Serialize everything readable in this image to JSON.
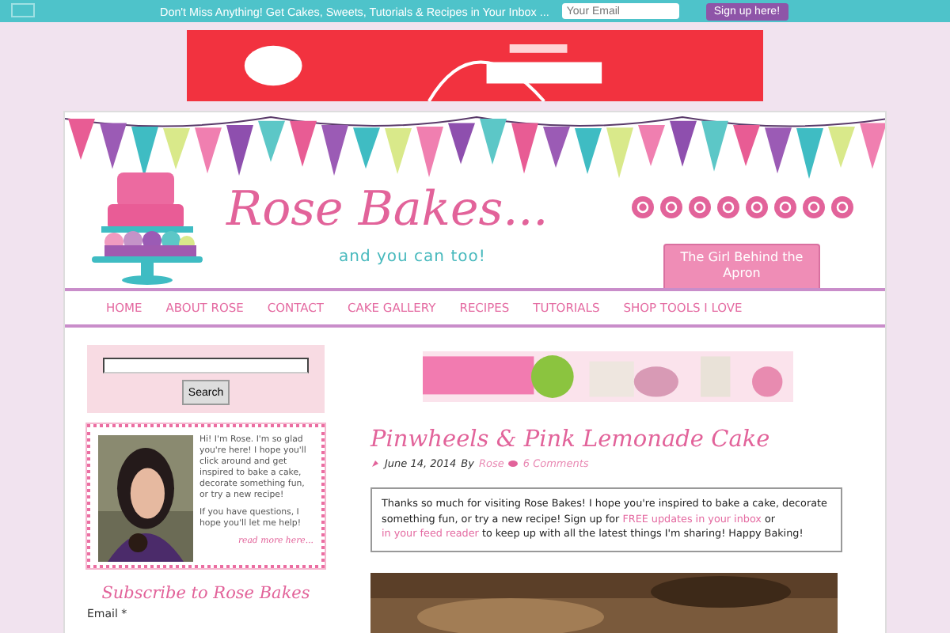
{
  "top_bar": {
    "message": "Don't Miss Anything! Get Cakes, Sweets, Tutorials & Recipes in Your Inbox ...",
    "email_placeholder": "Your Email",
    "button": "Sign up here!"
  },
  "header": {
    "logo_title": "Rose Bakes...",
    "tagline": "and you can too!",
    "about_tab": "The Girl Behind the Apron"
  },
  "nav": {
    "items": [
      "HOME",
      "ABOUT ROSE",
      "CONTACT",
      "CAKE GALLERY",
      "RECIPES",
      "TUTORIALS",
      "SHOP TOOLS I LOVE"
    ]
  },
  "sidebar": {
    "search_button": "Search",
    "about": {
      "paragraphs": [
        "Hi! I'm Rose.  I'm so glad you're here!  I hope you'll click around and get inspired to bake a cake, decorate something fun, or try a new recipe!",
        "If you have questions, I hope you'll let me help!"
      ],
      "link": "read more here..."
    },
    "subscribe_title": "Subscribe to Rose Bakes",
    "email_label": "Email *"
  },
  "post": {
    "title": "Pinwheels & Pink Lemonade Cake",
    "date": "June 14, 2014",
    "by": "By",
    "author": "Rose",
    "comments": "6 Comments",
    "notice": [
      {
        "text": "Thanks so much for visiting Rose Bakes! I hope you're inspired to bake a cake, decorate something fun, or try a new recipe! Sign up for ",
        "kind": "text"
      },
      {
        "text": "FREE updates in your inbox",
        "kind": "link"
      },
      {
        "text": " or ",
        "kind": "text"
      },
      {
        "text": "in your feed reader",
        "kind": "link"
      },
      {
        "text": " to keep up with all the latest things I'm sharing! Happy Baking!",
        "kind": "text"
      }
    ]
  }
}
